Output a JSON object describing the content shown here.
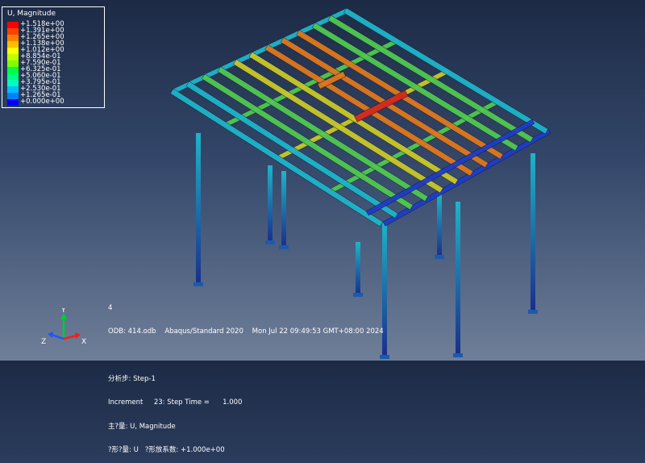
{
  "legend": {
    "title": "U, Magnitude",
    "entries": [
      {
        "label": "+1.518e+00",
        "color": "#ff0000"
      },
      {
        "label": "+1.391e+00",
        "color": "#ff4000"
      },
      {
        "label": "+1.265e+00",
        "color": "#ff8000"
      },
      {
        "label": "+1.138e+00",
        "color": "#ffbf00"
      },
      {
        "label": "+1.012e+00",
        "color": "#ffff00"
      },
      {
        "label": "+8.854e-01",
        "color": "#bfff00"
      },
      {
        "label": "+7.590e-01",
        "color": "#80ff00"
      },
      {
        "label": "+6.325e-01",
        "color": "#00ff40"
      },
      {
        "label": "+5.060e-01",
        "color": "#00ff80"
      },
      {
        "label": "+3.795e-01",
        "color": "#00ffbf"
      },
      {
        "label": "+2.530e-01",
        "color": "#00bfff"
      },
      {
        "label": "+1.265e-01",
        "color": "#0080ff"
      },
      {
        "label": "+0.000e+00",
        "color": "#0000ff"
      }
    ]
  },
  "info": {
    "frame": "4",
    "odb_line": "ODB: 414.odb    Abaqus/Standard 2020    Mon Jul 22 09:49:53 GMT+08:00 2024",
    "step_line": "分析步: Step-1",
    "increment_line": "Increment     23: Step Time =      1.000",
    "primary_line": "主?量: U, Magnitude",
    "deformed_line": "?形?量: U   ?形放系数: +1.000e+00"
  },
  "triad": {
    "y_label": "Y",
    "z_label": "Z",
    "x_label": "X",
    "y_color": "#00cc33",
    "z_color": "#2255ff",
    "x_color": "#ee2222"
  },
  "model_colors": {
    "blue": "#1e3cc8",
    "cyan": "#1eb4c8",
    "green": "#50c850",
    "yellow": "#c8c828",
    "orange": "#dc781e",
    "red": "#d2281e",
    "column": "#1e5aaa"
  }
}
